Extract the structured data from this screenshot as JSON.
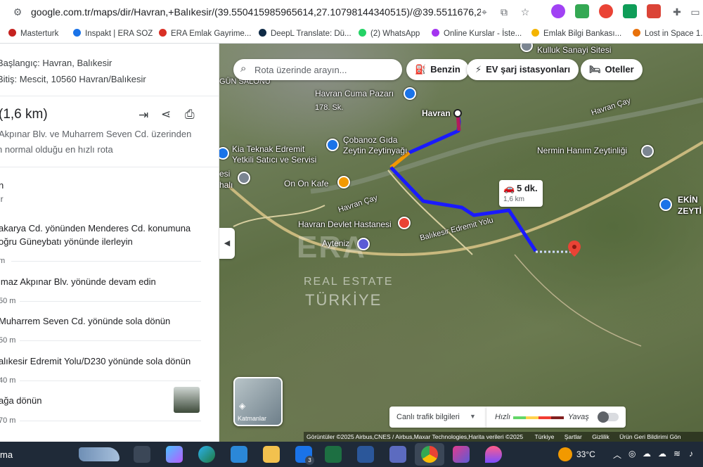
{
  "browser": {
    "url": "google.com.tr/maps/dir/Havran,+Balıkesir/(39.550415985965614,27.10798144340515)/@39.5511676,27.09..."
  },
  "bookmarks": [
    {
      "label": "Masterturk",
      "color": "#c5221f"
    },
    {
      "label": "Inspakt | ERA SOZ",
      "color": "#1a73e8"
    },
    {
      "label": "ERA Emlak Gayrime...",
      "color": "#d93025"
    },
    {
      "label": "DeepL Translate: Dü...",
      "color": "#0f2b46"
    },
    {
      "label": "(2) WhatsApp",
      "color": "#25d366"
    },
    {
      "label": "Online Kurslar - İste...",
      "color": "#a435f0"
    },
    {
      "label": "Emlak Bilgi Bankası...",
      "color": "#f4b400"
    },
    {
      "label": "Lost in Space 1. S...",
      "color": "#e8710a"
    }
  ],
  "panel": {
    "start": "Başlangıç: Havran, Balıkesir",
    "end": "Bitiş: Mescit, 10560 Havran/Balıkesir",
    "distance": "(1,6 km)",
    "via": "Akpınar Blv. ve Muharrem Seven Cd. üzerinden",
    "route_note": "n normal olduğu en hızlı rota",
    "origin_short": "n",
    "origin_sub": "ir",
    "steps": [
      {
        "line1": "akarya Cd. yönünden Menderes Cd. konumuna",
        "line2": "oğru Güneybatı yönünde ilerleyin",
        "dist": "m"
      },
      {
        "line1": "lmaz Akpınar Blv. yönünde devam edin",
        "line2": "",
        "dist": "50 m"
      },
      {
        "line1": "Muharrem Seven Cd. yönünde sola dönün",
        "line2": "",
        "dist": "50 m"
      },
      {
        "line1": "alıkesir Edremit Yolu/D230 yönünde sola dönün",
        "line2": "",
        "dist": "40 m"
      },
      {
        "line1": "ağa dönün",
        "line2": "",
        "dist": "70 m"
      }
    ]
  },
  "map": {
    "search_placeholder": "Rota üzerinde arayın...",
    "chips": [
      "Benzin",
      "EV şarj istasyonları",
      "Oteller"
    ],
    "route_time": "5 dk.",
    "route_dist": "1,6 km",
    "labels": {
      "kulluk": "Kulluk Sanayi Sitesi",
      "gun_salonu": "GÜN SALONU",
      "cuma_pazari": "Havran Cuma Pazarı",
      "street_178": "178. Sk.",
      "havran": "Havran",
      "cobanoz": "Çobanoz Gıda",
      "zeytin": "Zeytin Zeytinyağı",
      "nermin": "Nermin Hanım Zeytinliği",
      "kia": "Kia Teknak Edremit",
      "kia2": "Yetkili Satıcı ve Servisi",
      "onon": "On On Kafe",
      "havran_cay": "Havran Çay",
      "havran_cay2": "Havran Çay",
      "hastane": "Havran Devlet Hastanesi",
      "ayteniz": "Ayteniz",
      "balikesir_yolu": "Balıkesir Edremit Yolu",
      "ekin": "EKİN",
      "zeyti": "ZEYTİ",
      "esi": "esi",
      "hali": "halı"
    },
    "layers_label": "Katmanlar",
    "traffic_label": "Canlı trafik bilgileri",
    "traffic_fast": "Hızlı",
    "traffic_slow": "Yavaş",
    "attribution": "Görüntüler ©2025 Airbus,CNES / Airbus,Maxar Technologies,Harita verileri ©2025",
    "footer_links": [
      "Türkiye",
      "Şartlar",
      "Gizlilik",
      "Ürün Geri Bildirimi Gön"
    ],
    "watermark_brand": "ERA",
    "watermark_line1": "REAL ESTATE",
    "watermark_line2": "TÜRKİYE"
  },
  "taskbar": {
    "search_text": "ma",
    "mail_badge": "3",
    "temperature": "33°C"
  }
}
